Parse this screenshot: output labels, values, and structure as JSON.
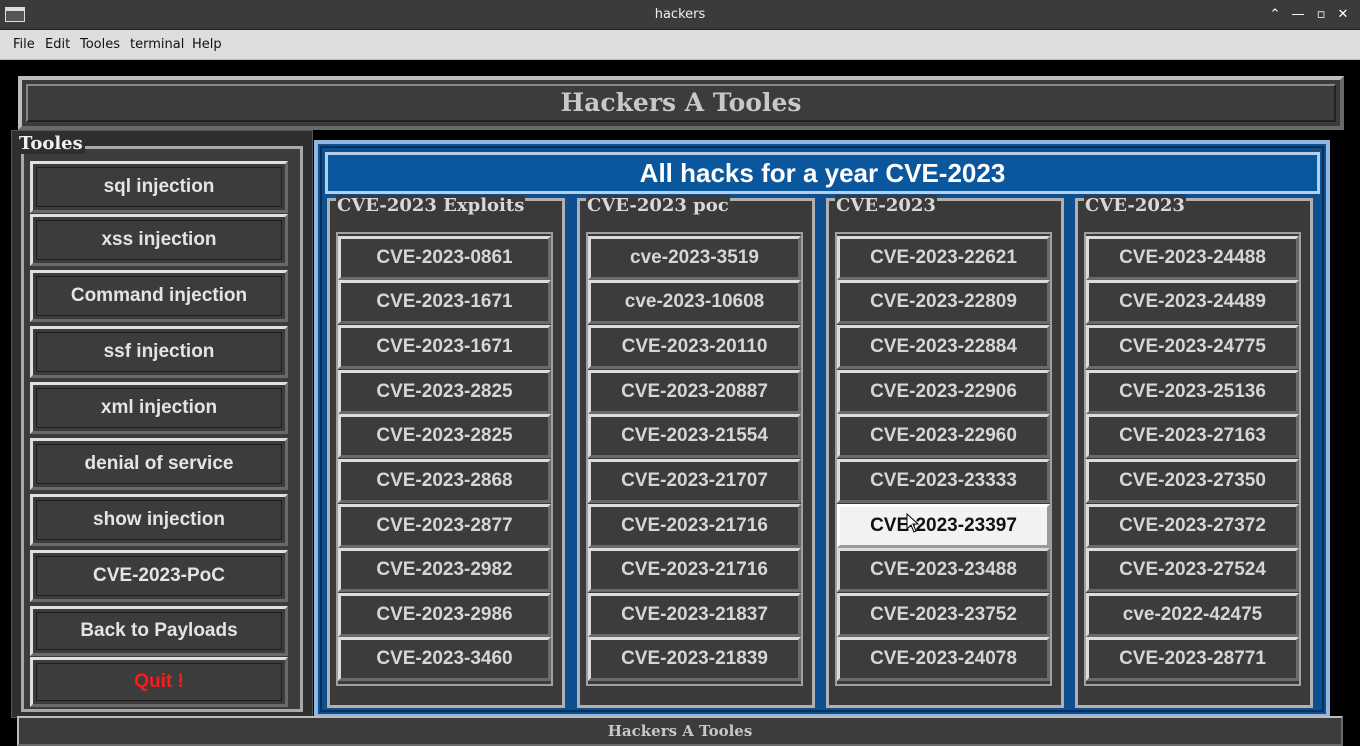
{
  "window": {
    "title": "hackers",
    "controls": {
      "collapse": "⌃",
      "minimize": "—",
      "maximize": "▫",
      "close": "✕"
    }
  },
  "menu": [
    "File",
    "Edit",
    "Tooles",
    "terminal",
    "Help"
  ],
  "header": {
    "title": "Hackers A Tooles"
  },
  "sidebar": {
    "title": "Tooles",
    "buttons": [
      {
        "label": "sql injection"
      },
      {
        "label": "xss injection"
      },
      {
        "label": "Command injection"
      },
      {
        "label": "ssf injection"
      },
      {
        "label": "xml injection"
      },
      {
        "label": "denial of service"
      },
      {
        "label": "show injection"
      },
      {
        "label": "CVE-2023-PoC"
      },
      {
        "label": "Back to Payloads"
      },
      {
        "label": "Quit !",
        "color": "#ff1a1a"
      }
    ]
  },
  "main": {
    "title": "All hacks for a year CVE-2023",
    "columns": [
      {
        "title": "CVE-2023 Exploits",
        "items": [
          "CVE-2023-0861",
          "CVE-2023-1671",
          "CVE-2023-1671",
          "CVE-2023-2825",
          "CVE-2023-2825",
          "CVE-2023-2868",
          "CVE-2023-2877",
          "CVE-2023-2982",
          "CVE-2023-2986",
          "CVE-2023-3460"
        ]
      },
      {
        "title": "CVE-2023 poc",
        "items": [
          "cve-2023-3519",
          "cve-2023-10608",
          "CVE-2023-20110",
          "CVE-2023-20887",
          "CVE-2023-21554",
          "CVE-2023-21707",
          "CVE-2023-21716",
          "CVE-2023-21716",
          "CVE-2023-21837",
          "CVE-2023-21839"
        ]
      },
      {
        "title": "CVE-2023",
        "items": [
          "CVE-2023-22621",
          "CVE-2023-22809",
          "CVE-2023-22884",
          "CVE-2023-22906",
          "CVE-2023-22960",
          "CVE-2023-23333",
          "CVE-2023-23397",
          "CVE-2023-23488",
          "CVE-2023-23752",
          "CVE-2023-24078"
        ],
        "active_index": 6
      },
      {
        "title": "CVE-2023",
        "items": [
          "CVE-2023-24488",
          "CVE-2023-24489",
          "CVE-2023-24775",
          "CVE-2023-25136",
          "CVE-2023-27163",
          "CVE-2023-27350",
          "CVE-2023-27372",
          "CVE-2023-27524",
          "cve-2022-42475",
          "CVE-2023-28771"
        ]
      }
    ]
  },
  "footer": {
    "title": "Hackers A Tooles"
  },
  "colors": {
    "panel": "#3c3c3c",
    "main_blue": "#0d4f8f",
    "quit_red": "#ff1a1a"
  }
}
